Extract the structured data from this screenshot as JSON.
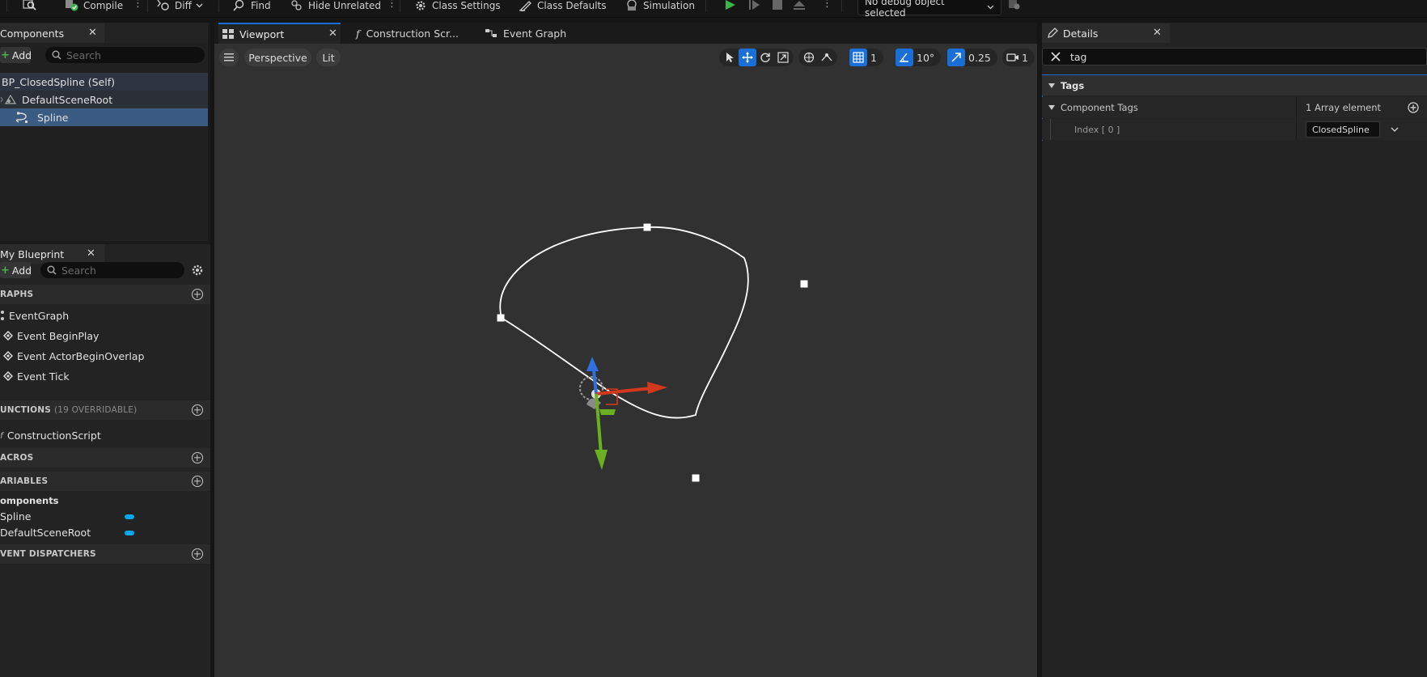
{
  "toolbar": {
    "compile_label": "Compile",
    "diff_label": "Diff",
    "find_label": "Find",
    "hide_unrelated_label": "Hide Unrelated",
    "class_settings_label": "Class Settings",
    "class_defaults_label": "Class Defaults",
    "simulation_label": "Simulation",
    "debug_object_label": "No debug object selected"
  },
  "components": {
    "tab_label": "Components",
    "add_label": "Add",
    "search_placeholder": "Search",
    "items": [
      {
        "label": "BP_ClosedSpline (Self)"
      },
      {
        "label": "DefaultSceneRoot"
      },
      {
        "label": "Spline"
      }
    ]
  },
  "my_blueprint": {
    "tab_label": "My Blueprint",
    "add_label": "Add",
    "search_placeholder": "Search",
    "graphs_header": "RAPHS",
    "graphs": [
      {
        "label": "EventGraph"
      },
      {
        "label": "Event BeginPlay"
      },
      {
        "label": "Event ActorBeginOverlap"
      },
      {
        "label": "Event Tick"
      }
    ],
    "functions_header": "UNCTIONS",
    "functions_overridable": "(19 OVERRIDABLE)",
    "functions": [
      {
        "label": "ConstructionScript"
      }
    ],
    "macros_header": "ACROS",
    "variables_header": "ARIABLES",
    "variables_group": "omponents",
    "variables": [
      {
        "label": "Spline"
      },
      {
        "label": "DefaultSceneRoot"
      }
    ],
    "dispatchers_header": "VENT DISPATCHERS"
  },
  "viewport_tabs": {
    "viewport": "Viewport",
    "construction": "Construction Scr...",
    "event_graph": "Event Graph"
  },
  "viewport": {
    "perspective_label": "Perspective",
    "lit_label": "Lit",
    "grid_value": "1",
    "angle_value": "10°",
    "scale_value": "0.25",
    "camera_value": "1"
  },
  "details": {
    "tab_label": "Details",
    "search_value": "tag",
    "section_label": "Tags",
    "component_tags_label": "Component Tags",
    "array_count_label": "1 Array element",
    "index_label": "Index [ 0 ]",
    "index_value": "ClosedSpline"
  },
  "colors": {
    "accent_blue": "#1a6fd6",
    "selected_row": "#3a5b82",
    "variable_pill": "#00a8f0",
    "play_green": "#39b54a"
  }
}
